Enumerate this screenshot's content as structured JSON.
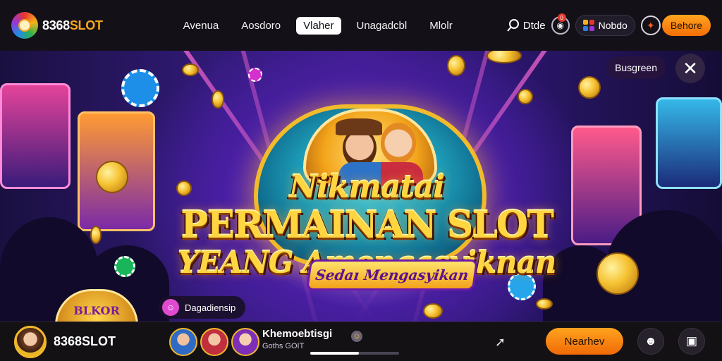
{
  "header": {
    "brand_number": "8368",
    "brand_word": "SLOT",
    "nav": [
      {
        "label": "Avenua",
        "active": false
      },
      {
        "label": "Aosdoro",
        "active": false
      },
      {
        "label": "Vlaher",
        "active": true
      },
      {
        "label": "Unagadcbl",
        "active": false
      },
      {
        "label": "Mlolr",
        "active": false
      }
    ],
    "search_label": "Dtde",
    "notification_count": "0",
    "user_label": "Nobdo",
    "cta_label": "Behore"
  },
  "hero": {
    "title_line1": "Nikmatai",
    "title_line2": "PERMAINAN SLOT",
    "title_line3": "YEANG Amengasyiknan",
    "subtitle": "Sedaı Mengasyikan",
    "tag_label": "Busgreen",
    "chat_label": "Dagadiensip",
    "badge_label": "BLKOR"
  },
  "footer": {
    "brand_number": "8368",
    "brand_word": "SLOT",
    "title": "Khemoebtisgi",
    "meta": "Goths GOIT",
    "progress": 0.55,
    "cta_label": "Nearhev"
  },
  "colors": {
    "accent_orange": "#f7a51d",
    "title_gold": "#ffd640",
    "hero_purple": "#4a1fa5"
  },
  "icons": [
    "brand-logo-icon",
    "search-icon",
    "bell-icon",
    "grid-icon",
    "swirl-icon",
    "close-icon",
    "chat-icon",
    "smile-icon",
    "pin-icon",
    "alien-icon",
    "expand-icon"
  ]
}
